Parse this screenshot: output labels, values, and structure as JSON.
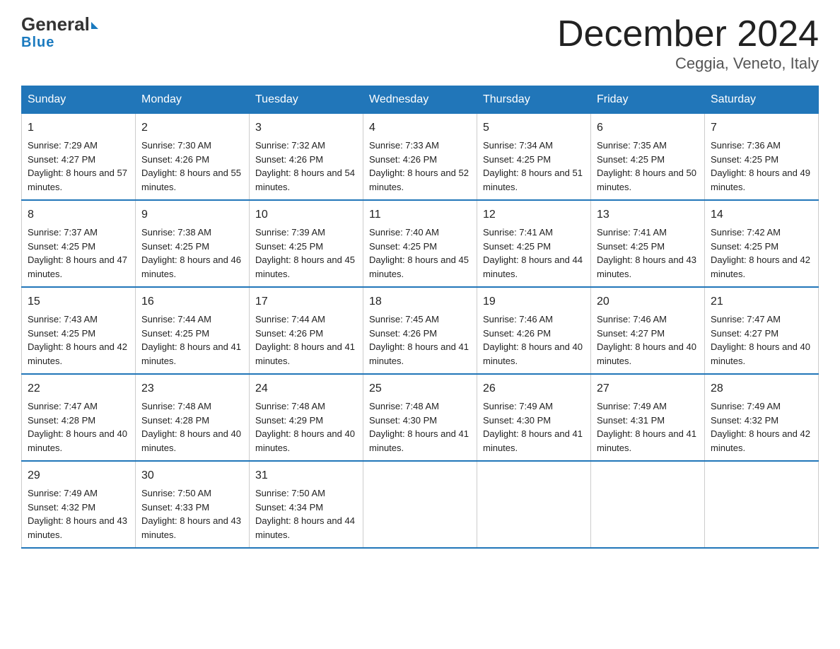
{
  "logo": {
    "general": "General",
    "blue": "Blue"
  },
  "title": "December 2024",
  "subtitle": "Ceggia, Veneto, Italy",
  "days": [
    "Sunday",
    "Monday",
    "Tuesday",
    "Wednesday",
    "Thursday",
    "Friday",
    "Saturday"
  ],
  "weeks": [
    [
      {
        "num": "1",
        "sunrise": "7:29 AM",
        "sunset": "4:27 PM",
        "daylight": "8 hours and 57 minutes."
      },
      {
        "num": "2",
        "sunrise": "7:30 AM",
        "sunset": "4:26 PM",
        "daylight": "8 hours and 55 minutes."
      },
      {
        "num": "3",
        "sunrise": "7:32 AM",
        "sunset": "4:26 PM",
        "daylight": "8 hours and 54 minutes."
      },
      {
        "num": "4",
        "sunrise": "7:33 AM",
        "sunset": "4:26 PM",
        "daylight": "8 hours and 52 minutes."
      },
      {
        "num": "5",
        "sunrise": "7:34 AM",
        "sunset": "4:25 PM",
        "daylight": "8 hours and 51 minutes."
      },
      {
        "num": "6",
        "sunrise": "7:35 AM",
        "sunset": "4:25 PM",
        "daylight": "8 hours and 50 minutes."
      },
      {
        "num": "7",
        "sunrise": "7:36 AM",
        "sunset": "4:25 PM",
        "daylight": "8 hours and 49 minutes."
      }
    ],
    [
      {
        "num": "8",
        "sunrise": "7:37 AM",
        "sunset": "4:25 PM",
        "daylight": "8 hours and 47 minutes."
      },
      {
        "num": "9",
        "sunrise": "7:38 AM",
        "sunset": "4:25 PM",
        "daylight": "8 hours and 46 minutes."
      },
      {
        "num": "10",
        "sunrise": "7:39 AM",
        "sunset": "4:25 PM",
        "daylight": "8 hours and 45 minutes."
      },
      {
        "num": "11",
        "sunrise": "7:40 AM",
        "sunset": "4:25 PM",
        "daylight": "8 hours and 45 minutes."
      },
      {
        "num": "12",
        "sunrise": "7:41 AM",
        "sunset": "4:25 PM",
        "daylight": "8 hours and 44 minutes."
      },
      {
        "num": "13",
        "sunrise": "7:41 AM",
        "sunset": "4:25 PM",
        "daylight": "8 hours and 43 minutes."
      },
      {
        "num": "14",
        "sunrise": "7:42 AM",
        "sunset": "4:25 PM",
        "daylight": "8 hours and 42 minutes."
      }
    ],
    [
      {
        "num": "15",
        "sunrise": "7:43 AM",
        "sunset": "4:25 PM",
        "daylight": "8 hours and 42 minutes."
      },
      {
        "num": "16",
        "sunrise": "7:44 AM",
        "sunset": "4:25 PM",
        "daylight": "8 hours and 41 minutes."
      },
      {
        "num": "17",
        "sunrise": "7:44 AM",
        "sunset": "4:26 PM",
        "daylight": "8 hours and 41 minutes."
      },
      {
        "num": "18",
        "sunrise": "7:45 AM",
        "sunset": "4:26 PM",
        "daylight": "8 hours and 41 minutes."
      },
      {
        "num": "19",
        "sunrise": "7:46 AM",
        "sunset": "4:26 PM",
        "daylight": "8 hours and 40 minutes."
      },
      {
        "num": "20",
        "sunrise": "7:46 AM",
        "sunset": "4:27 PM",
        "daylight": "8 hours and 40 minutes."
      },
      {
        "num": "21",
        "sunrise": "7:47 AM",
        "sunset": "4:27 PM",
        "daylight": "8 hours and 40 minutes."
      }
    ],
    [
      {
        "num": "22",
        "sunrise": "7:47 AM",
        "sunset": "4:28 PM",
        "daylight": "8 hours and 40 minutes."
      },
      {
        "num": "23",
        "sunrise": "7:48 AM",
        "sunset": "4:28 PM",
        "daylight": "8 hours and 40 minutes."
      },
      {
        "num": "24",
        "sunrise": "7:48 AM",
        "sunset": "4:29 PM",
        "daylight": "8 hours and 40 minutes."
      },
      {
        "num": "25",
        "sunrise": "7:48 AM",
        "sunset": "4:30 PM",
        "daylight": "8 hours and 41 minutes."
      },
      {
        "num": "26",
        "sunrise": "7:49 AM",
        "sunset": "4:30 PM",
        "daylight": "8 hours and 41 minutes."
      },
      {
        "num": "27",
        "sunrise": "7:49 AM",
        "sunset": "4:31 PM",
        "daylight": "8 hours and 41 minutes."
      },
      {
        "num": "28",
        "sunrise": "7:49 AM",
        "sunset": "4:32 PM",
        "daylight": "8 hours and 42 minutes."
      }
    ],
    [
      {
        "num": "29",
        "sunrise": "7:49 AM",
        "sunset": "4:32 PM",
        "daylight": "8 hours and 43 minutes."
      },
      {
        "num": "30",
        "sunrise": "7:50 AM",
        "sunset": "4:33 PM",
        "daylight": "8 hours and 43 minutes."
      },
      {
        "num": "31",
        "sunrise": "7:50 AM",
        "sunset": "4:34 PM",
        "daylight": "8 hours and 44 minutes."
      },
      null,
      null,
      null,
      null
    ]
  ]
}
